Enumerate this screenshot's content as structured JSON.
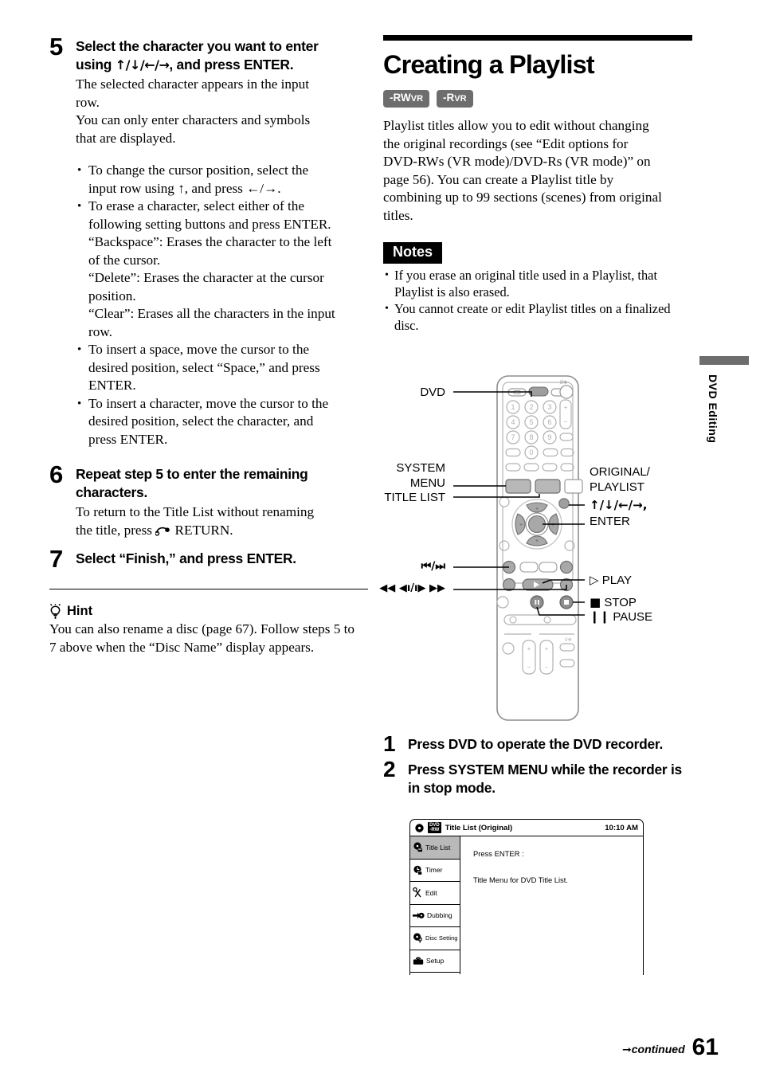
{
  "left_column": {
    "steps": [
      {
        "num": "5",
        "title_a": "Select the character you want to enter",
        "title_b_prefix": "using ",
        "title_b_arrows": "↑/↓/←/→",
        "title_b_suffix": ", and press ENTER.",
        "desc_lines": [
          "The selected character appears in the input",
          "row.",
          "You can only enter characters and symbols",
          "that are displayed."
        ]
      },
      {
        "num": "6",
        "title_a": "Repeat step 5 to enter the remaining",
        "title_b": "characters.",
        "desc_lines": [
          "To return to the Title List without renaming",
          "the title, press ↺ RETURN."
        ]
      },
      {
        "num": "7",
        "title_a": "Select “Finish,” and press ENTER."
      }
    ],
    "bullets": [
      {
        "lines": [
          "To change the cursor position, select the",
          "input row using ↑, and press ←/→."
        ]
      },
      {
        "lines": [
          "To erase a character, select either of the",
          "following setting buttons and press ENTER.",
          "“Backspace”: Erases the character to the left",
          "of the cursor.",
          "“Delete”: Erases the character at the cursor",
          "position.",
          "“Clear”: Erases all the characters in the input",
          "row."
        ]
      },
      {
        "lines": [
          "To insert a space, move the cursor to the",
          "desired position, select “Space,” and press",
          "ENTER."
        ]
      },
      {
        "lines": [
          "To insert a character, move the cursor to the",
          "desired position, select the character, and",
          "press ENTER."
        ]
      }
    ],
    "hint": {
      "heading": "Hint",
      "lines": [
        "You can also rename a disc (page 67). Follow steps 5 to",
        "7 above when the “Disc Name” display appears."
      ]
    }
  },
  "right_column": {
    "section_title": "Creating a Playlist",
    "badges": [
      {
        "main": "-RW",
        "sub": "VR"
      },
      {
        "main": "-R",
        "sub": "VR"
      }
    ],
    "intro_lines": [
      "Playlist titles allow you to edit without changing",
      "the original recordings (see “Edit options for",
      "DVD-RWs (VR mode)/DVD-Rs (VR mode)” on",
      "page 56). You can create a Playlist title by",
      "combining up to 99 sections (scenes) from original",
      "titles."
    ],
    "notes_label": "Notes",
    "notes": [
      {
        "lines": [
          "If you erase an original title used in a Playlist, that",
          "Playlist is also erased."
        ]
      },
      {
        "lines": [
          "You cannot create or edit Playlist titles on a finalized",
          "disc."
        ]
      }
    ],
    "steps": [
      {
        "num": "1",
        "lines": [
          "Press DVD to operate the DVD recorder."
        ]
      },
      {
        "num": "2",
        "lines": [
          "Press SYSTEM MENU while the recorder is",
          "in stop mode."
        ]
      }
    ]
  },
  "side_tab": {
    "label": "DVD Editing"
  },
  "remote_callouts": {
    "dvd": "DVD",
    "system": "SYSTEM",
    "menu": "MENU",
    "title_list": "TITLE LIST",
    "prev_next": "⏮/⏭",
    "scan": "◀◀ ◀ı/ı▶ ▶▶",
    "original": "ORIGINAL/",
    "playlist": "PLAYLIST",
    "dpad_arrows": "↑/↓/←/→,",
    "enter": "ENTER",
    "play": "PLAY",
    "stop": "STOP",
    "pause": "PAUSE"
  },
  "tv_screen": {
    "title": "Title List (Original)",
    "disc_badge_line1": "DVD",
    "disc_badge_line2": "-RW",
    "time": "10:10 AM",
    "menu_items": [
      {
        "label": "Title List",
        "icon": "disc-list-icon",
        "selected": true
      },
      {
        "label": "Timer",
        "icon": "clock-icon",
        "selected": false
      },
      {
        "label": "Edit",
        "icon": "scissors-icon",
        "selected": false
      },
      {
        "label": "Dubbing",
        "icon": "dubbing-arrow-icon",
        "selected": false
      },
      {
        "label": "Disc Setting",
        "icon": "disc-wrench-icon",
        "selected": false
      },
      {
        "label": "Setup",
        "icon": "toolbox-icon",
        "selected": false
      }
    ],
    "main_line1": "Press ENTER :",
    "main_line2": "Title Menu for DVD Title List."
  },
  "footer": {
    "continued": "continued",
    "page_number": "61"
  },
  "colors": {
    "badge_gray": "#6d6d6d",
    "black": "#000000",
    "selected_menu_gray": "#b9b9b9",
    "remote_body": "#ffffff",
    "remote_button_gray": "#c9c9c9"
  }
}
